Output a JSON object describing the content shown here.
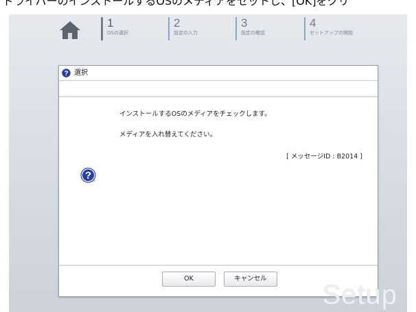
{
  "top_caption": "ドライバーのインストールするOSのメディアをセットし、[OK]をクリ",
  "steps": [
    {
      "num": "1",
      "label": "OSの選択"
    },
    {
      "num": "2",
      "label": "設定の入力"
    },
    {
      "num": "3",
      "label": "設定の確認"
    },
    {
      "num": "4",
      "label": "セットアップの開始"
    }
  ],
  "dialog": {
    "title": "選択",
    "message_line1": "インストールするOSのメディアをチェックします。",
    "message_line2": "メディアを入れ替えてください。",
    "message_id": "[ メッセージID : B2014 ]",
    "ok_label": "OK",
    "cancel_label": "キャンセル"
  },
  "watermark": "Setup",
  "colors": {
    "background": "#d6dae1",
    "help_icon": "#2b3f9a",
    "step_bar": "#8da4c4"
  }
}
